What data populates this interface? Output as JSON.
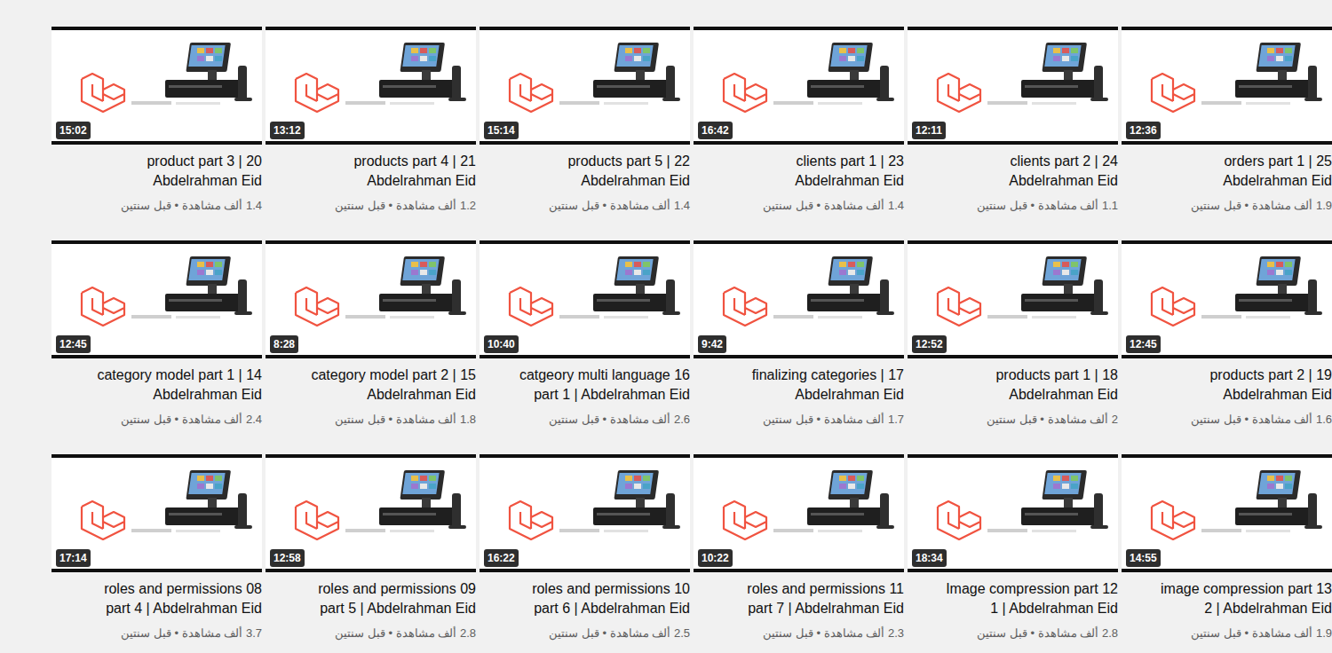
{
  "videos": [
    {
      "duration": "12:36",
      "title": [
        "orders part 1 | 25",
        "Abdelrahman Eid"
      ],
      "meta": "1.9 ألف مشاهدة • قبل سنتين"
    },
    {
      "duration": "12:11",
      "title": [
        "clients part 2 | 24",
        "Abdelrahman Eid"
      ],
      "meta": "1.1 ألف مشاهدة • قبل سنتين"
    },
    {
      "duration": "16:42",
      "title": [
        "clients part 1 | 23",
        "Abdelrahman Eid"
      ],
      "meta": "1.4 ألف مشاهدة • قبل سنتين"
    },
    {
      "duration": "15:14",
      "title": [
        "products part 5 | 22",
        "Abdelrahman Eid"
      ],
      "meta": "1.4 ألف مشاهدة • قبل سنتين"
    },
    {
      "duration": "13:12",
      "title": [
        "products part 4 | 21",
        "Abdelrahman Eid"
      ],
      "meta": "1.2 ألف مشاهدة • قبل سنتين"
    },
    {
      "duration": "15:02",
      "title": [
        "product part 3 | 20",
        "Abdelrahman Eid"
      ],
      "meta": "1.4 ألف مشاهدة • قبل سنتين"
    },
    {
      "duration": "12:45",
      "title": [
        "products part 2 | 19",
        "Abdelrahman Eid"
      ],
      "meta": "1.6 ألف مشاهدة • قبل سنتين"
    },
    {
      "duration": "12:52",
      "title": [
        "products part 1 | 18",
        "Abdelrahman Eid"
      ],
      "meta": "2 ألف مشاهدة • قبل سنتين"
    },
    {
      "duration": "9:42",
      "title": [
        "finalizing categories | 17",
        "Abdelrahman Eid"
      ],
      "meta": "1.7 ألف مشاهدة • قبل سنتين"
    },
    {
      "duration": "10:40",
      "title": [
        "catgeory multi language 16",
        "part 1 | Abdelrahman Eid"
      ],
      "meta": "2.6 ألف مشاهدة • قبل سنتين"
    },
    {
      "duration": "8:28",
      "title": [
        "category model part 2 | 15",
        "Abdelrahman Eid"
      ],
      "meta": "1.8 ألف مشاهدة • قبل سنتين"
    },
    {
      "duration": "12:45",
      "title": [
        "category model part 1 | 14",
        "Abdelrahman Eid"
      ],
      "meta": "2.4 ألف مشاهدة • قبل سنتين"
    },
    {
      "duration": "14:55",
      "title": [
        "image compression part 13",
        "2 | Abdelrahman Eid"
      ],
      "meta": "1.9 ألف مشاهدة • قبل سنتين"
    },
    {
      "duration": "18:34",
      "title": [
        "Image compression part 12",
        "1 | Abdelrahman Eid"
      ],
      "meta": "2.8 ألف مشاهدة • قبل سنتين"
    },
    {
      "duration": "10:22",
      "title": [
        "roles and permissions 11",
        "part 7 | Abdelrahman Eid"
      ],
      "meta": "2.3 ألف مشاهدة • قبل سنتين"
    },
    {
      "duration": "16:22",
      "title": [
        "roles and permissions 10",
        "part 6 | Abdelrahman Eid"
      ],
      "meta": "2.5 ألف مشاهدة • قبل سنتين"
    },
    {
      "duration": "12:58",
      "title": [
        "roles and permissions 09",
        "part 5 | Abdelrahman Eid"
      ],
      "meta": "2.8 ألف مشاهدة • قبل سنتين"
    },
    {
      "duration": "17:14",
      "title": [
        "roles and permissions 08",
        "part 4 | Abdelrahman Eid"
      ],
      "meta": "3.7 ألف مشاهدة • قبل سنتين"
    }
  ]
}
